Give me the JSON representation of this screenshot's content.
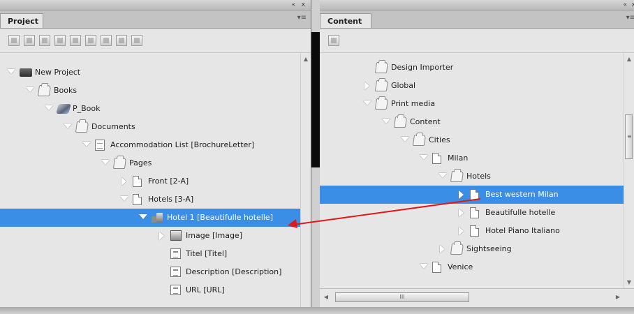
{
  "left_panel": {
    "title": "Project",
    "controls": {
      "collapse": "«",
      "close": "x"
    },
    "toolbar_icons": [
      "new-icon",
      "save-icon",
      "edit-icon",
      "add-icon",
      "duplicate-icon",
      "delete-icon",
      "blank-icon",
      "layout-icon",
      "refresh-icon"
    ],
    "tree": [
      {
        "label": "New Project",
        "level": 0,
        "twisty": "open",
        "icon": "project"
      },
      {
        "label": "Books",
        "level": 1,
        "twisty": "open",
        "icon": "folder"
      },
      {
        "label": "P_Book",
        "level": 2,
        "twisty": "open",
        "icon": "book"
      },
      {
        "label": "Documents",
        "level": 3,
        "twisty": "open",
        "icon": "folder"
      },
      {
        "label": "Accommodation List [BrochureLetter]",
        "level": 4,
        "twisty": "open",
        "icon": "doc"
      },
      {
        "label": "Pages",
        "level": 5,
        "twisty": "open",
        "icon": "folder"
      },
      {
        "label": "Front [2-A]",
        "level": 6,
        "twisty": "closed",
        "icon": "page"
      },
      {
        "label": "Hotels [3-A]",
        "level": 6,
        "twisty": "open",
        "icon": "page"
      },
      {
        "label": "Hotel 1 [Beautifulle hotelle]",
        "level": 7,
        "twisty": "open",
        "icon": "hotel",
        "selected": true
      },
      {
        "label": "Image [Image]",
        "level": 8,
        "twisty": "closed",
        "icon": "image"
      },
      {
        "label": "Titel [Titel]",
        "level": 8,
        "twisty": "none",
        "icon": "field"
      },
      {
        "label": "Description [Description]",
        "level": 8,
        "twisty": "none",
        "icon": "field"
      },
      {
        "label": "URL [URL]",
        "level": 8,
        "twisty": "none",
        "icon": "field"
      }
    ]
  },
  "right_panel": {
    "title": "Content",
    "controls": {
      "collapse": "«",
      "close": "x"
    },
    "toolbar_icons": [
      "refresh-icon"
    ],
    "tree": [
      {
        "label": "Design Importer",
        "level": 0,
        "twisty": "none",
        "icon": "folder"
      },
      {
        "label": "Global",
        "level": 0,
        "twisty": "closed",
        "icon": "folder"
      },
      {
        "label": "Print media",
        "level": 0,
        "twisty": "open",
        "icon": "folder"
      },
      {
        "label": "Content",
        "level": 1,
        "twisty": "open",
        "icon": "folder"
      },
      {
        "label": "Cities",
        "level": 2,
        "twisty": "open",
        "icon": "folder"
      },
      {
        "label": "Milan",
        "level": 3,
        "twisty": "open",
        "icon": "page"
      },
      {
        "label": "Hotels",
        "level": 4,
        "twisty": "open",
        "icon": "folder"
      },
      {
        "label": "Best western Milan",
        "level": 5,
        "twisty": "closed",
        "icon": "page",
        "selected": true
      },
      {
        "label": "Beautifulle hotelle",
        "level": 5,
        "twisty": "closed",
        "icon": "page"
      },
      {
        "label": "Hotel Piano Italiano",
        "level": 5,
        "twisty": "closed",
        "icon": "page"
      },
      {
        "label": "Sightseeing",
        "level": 4,
        "twisty": "closed",
        "icon": "folder"
      },
      {
        "label": "Venice",
        "level": 3,
        "twisty": "open",
        "icon": "page"
      }
    ],
    "hscroll_grip": "III"
  },
  "colors": {
    "selection": "#3b8ee6",
    "annotation_arrow": "#e01818"
  }
}
